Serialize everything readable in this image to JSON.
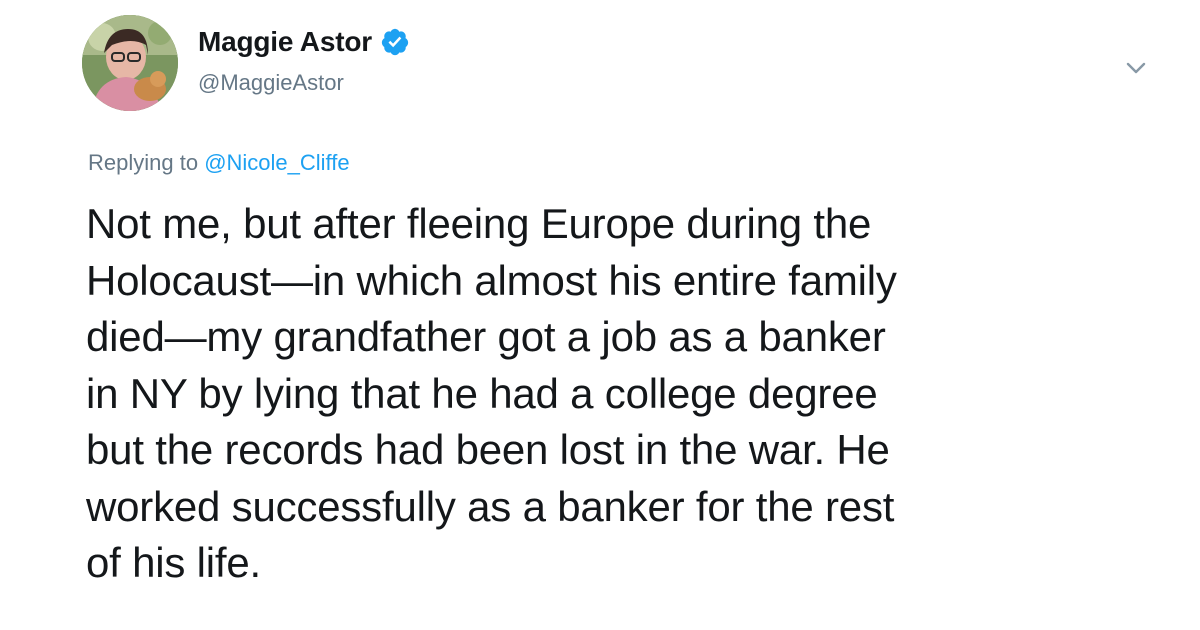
{
  "tweet": {
    "author": {
      "display_name": "Maggie Astor",
      "handle": "@MaggieAstor",
      "verified": true
    },
    "reply": {
      "prefix": "Replying to ",
      "mention": "@Nicole_Cliffe"
    },
    "text": "Not me, but after fleeing Europe during the\nHolocaust—in which almost his entire family\ndied—my grandfather got a job as a banker\nin NY by lying that he had a college degree\nbut the records had been lost in the war. He\nworked successfully as a banker for the rest\nof his life.",
    "icons": {
      "avatar": "profile-photo",
      "verified": "verified-badge-icon",
      "menu": "chevron-down-icon"
    },
    "colors": {
      "accent": "#1da1f2",
      "secondary_text": "#657786",
      "primary_text": "#14171a"
    }
  }
}
